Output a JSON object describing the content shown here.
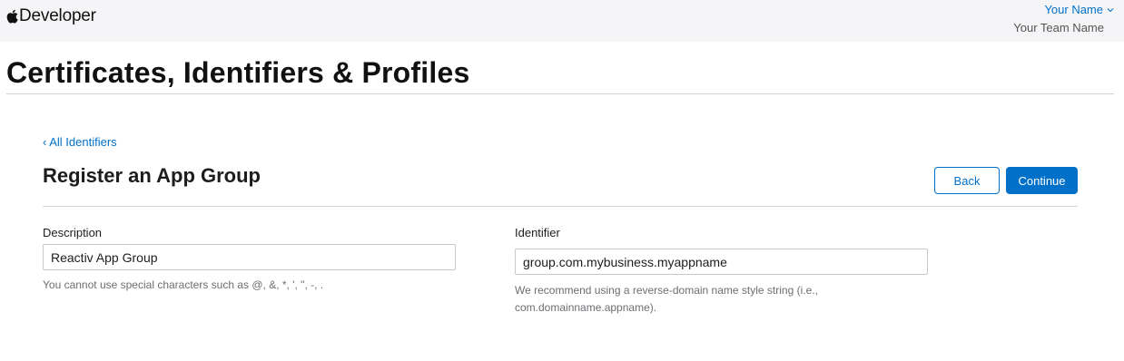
{
  "header": {
    "brand": "Developer",
    "user_name": "Your Name",
    "team_name": "Your Team Name"
  },
  "page": {
    "title": "Certificates, Identifiers & Profiles"
  },
  "nav": {
    "back_link": "‹ All Identifiers"
  },
  "form": {
    "title": "Register an App Group",
    "back_label": "Back",
    "continue_label": "Continue",
    "description": {
      "label": "Description",
      "value": "Reactiv App Group",
      "hint": "You cannot use special characters such as @, &, *, ', \", -, ."
    },
    "identifier": {
      "label": "Identifier",
      "value": "group.com.mybusiness.myappname",
      "hint_line1": "We recommend using a reverse-domain name style string (i.e.,",
      "hint_line2": "com.domainname.appname)."
    }
  },
  "colors": {
    "accent": "#0070c9",
    "topbar_bg": "#f5f5f7",
    "divider": "#d2d2d7"
  }
}
